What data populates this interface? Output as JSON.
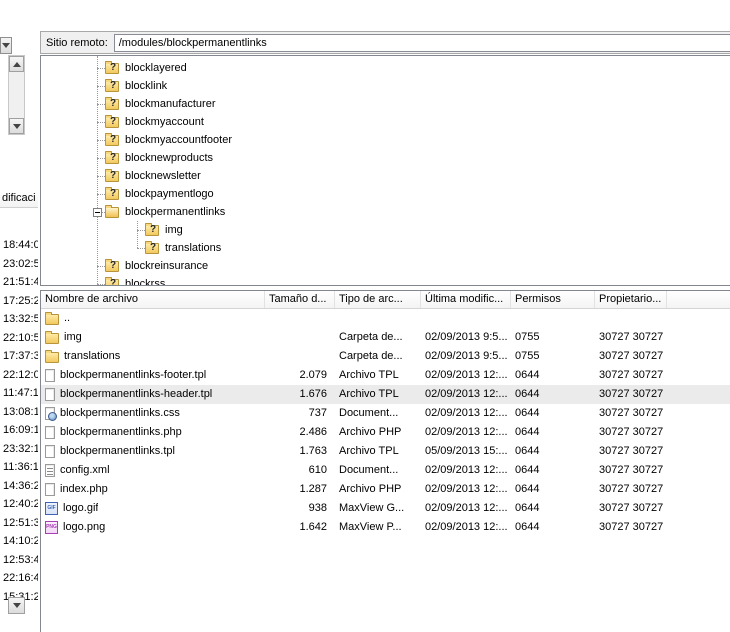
{
  "remote_site": {
    "label": "Sitio remoto:",
    "path": "/modules/blockpermanentlinks"
  },
  "left_panel": {
    "modified_header_fragment": "dificaci",
    "times": [
      "18:44:0",
      "23:02:5",
      "21:51:4",
      "17:25:2",
      "13:32:5",
      "22:10:5",
      "17:37:3",
      "22:12:0",
      "11:47:1",
      "13:08:1",
      "16:09:1",
      "23:32:1",
      "11:36:1",
      "14:36:2",
      "12:40:2",
      "12:51:3",
      "14:10:2",
      "12:53:4",
      "22:16:4",
      "15:31:2"
    ]
  },
  "tree": {
    "items": [
      {
        "label": "blocklayered",
        "icon": "folder-question",
        "depth": 1
      },
      {
        "label": "blocklink",
        "icon": "folder-question",
        "depth": 1
      },
      {
        "label": "blockmanufacturer",
        "icon": "folder-question",
        "depth": 1
      },
      {
        "label": "blockmyaccount",
        "icon": "folder-question",
        "depth": 1
      },
      {
        "label": "blockmyaccountfooter",
        "icon": "folder-question",
        "depth": 1
      },
      {
        "label": "blocknewproducts",
        "icon": "folder-question",
        "depth": 1
      },
      {
        "label": "blocknewsletter",
        "icon": "folder-question",
        "depth": 1
      },
      {
        "label": "blockpaymentlogo",
        "icon": "folder-question",
        "depth": 1
      },
      {
        "label": "blockpermanentlinks",
        "icon": "folder-open",
        "depth": 1,
        "expanded": true
      },
      {
        "label": "img",
        "icon": "folder-question",
        "depth": 2
      },
      {
        "label": "translations",
        "icon": "folder-question",
        "depth": 2
      },
      {
        "label": "blockreinsurance",
        "icon": "folder-question",
        "depth": 1
      },
      {
        "label": "blockrss",
        "icon": "folder-question",
        "depth": 1
      }
    ]
  },
  "file_list": {
    "columns": [
      "Nombre de archivo",
      "Tamaño d...",
      "Tipo de arc...",
      "Última modific...",
      "Permisos",
      "Propietario..."
    ],
    "rows": [
      {
        "name": "..",
        "icon": "folder",
        "size": "",
        "type": "",
        "modified": "",
        "perms": "",
        "owner": ""
      },
      {
        "name": "img",
        "icon": "folder",
        "size": "",
        "type": "Carpeta de...",
        "modified": "02/09/2013 9:5...",
        "perms": "0755",
        "owner": "30727 30727"
      },
      {
        "name": "translations",
        "icon": "folder",
        "size": "",
        "type": "Carpeta de...",
        "modified": "02/09/2013 9:5...",
        "perms": "0755",
        "owner": "30727 30727"
      },
      {
        "name": "blockpermanentlinks-footer.tpl",
        "icon": "page",
        "size": "2.079",
        "type": "Archivo TPL",
        "modified": "02/09/2013 12:...",
        "perms": "0644",
        "owner": "30727 30727"
      },
      {
        "name": "blockpermanentlinks-header.tpl",
        "icon": "page",
        "size": "1.676",
        "type": "Archivo TPL",
        "modified": "02/09/2013 12:...",
        "perms": "0644",
        "owner": "30727 30727",
        "selected": true
      },
      {
        "name": "blockpermanentlinks.css",
        "icon": "page-gear",
        "size": "737",
        "type": "Document...",
        "modified": "02/09/2013 12:...",
        "perms": "0644",
        "owner": "30727 30727"
      },
      {
        "name": "blockpermanentlinks.php",
        "icon": "page",
        "size": "2.486",
        "type": "Archivo PHP",
        "modified": "02/09/2013 12:...",
        "perms": "0644",
        "owner": "30727 30727"
      },
      {
        "name": "blockpermanentlinks.tpl",
        "icon": "page",
        "size": "1.763",
        "type": "Archivo TPL",
        "modified": "05/09/2013 15:...",
        "perms": "0644",
        "owner": "30727 30727"
      },
      {
        "name": "config.xml",
        "icon": "page-lines",
        "size": "610",
        "type": "Document...",
        "modified": "02/09/2013 12:...",
        "perms": "0644",
        "owner": "30727 30727"
      },
      {
        "name": "index.php",
        "icon": "page",
        "size": "1.287",
        "type": "Archivo PHP",
        "modified": "02/09/2013 12:...",
        "perms": "0644",
        "owner": "30727 30727"
      },
      {
        "name": "logo.gif",
        "icon": "gif",
        "size": "938",
        "type": "MaxView G...",
        "modified": "02/09/2013 12:...",
        "perms": "0644",
        "owner": "30727 30727"
      },
      {
        "name": "logo.png",
        "icon": "png",
        "size": "1.642",
        "type": "MaxView P...",
        "modified": "02/09/2013 12:...",
        "perms": "0644",
        "owner": "30727 30727"
      }
    ]
  }
}
